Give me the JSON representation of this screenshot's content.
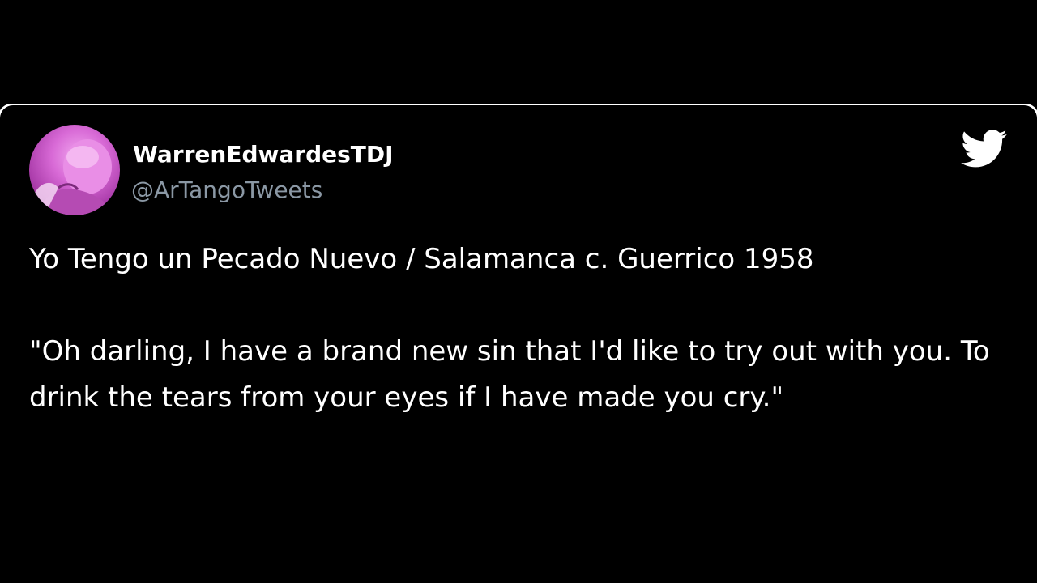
{
  "tweet": {
    "display_name": "WarrenEdwardesTDJ",
    "handle": "@ArTangoTweets",
    "avatar_icon": "profile-photo",
    "brand_icon": "twitter-bird-icon",
    "text_line_1": "Yo Tengo un Pecado Nuevo / Salamanca c. Guerrico 1958",
    "text_quote": "\"Oh darling, I have a brand new sin that I'd like to try out with you. To drink the tears from your eyes if I have made you cry.\""
  },
  "colors": {
    "background": "#000000",
    "text": "#ffffff",
    "handle": "#8b98a5",
    "avatar_tint": "#d86ad6"
  }
}
